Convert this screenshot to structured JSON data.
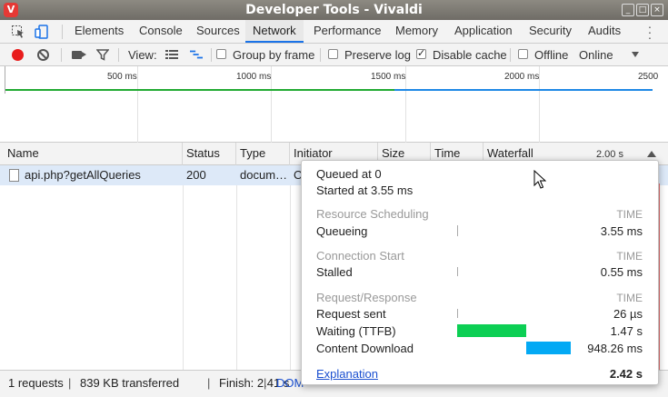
{
  "window": {
    "title": "Developer Tools - Vivaldi",
    "app_icon": "V",
    "controls": {
      "minimize": "_",
      "maximize": "□",
      "close": "×"
    }
  },
  "tabs": [
    {
      "label": "Elements",
      "active": false
    },
    {
      "label": "Console",
      "active": false
    },
    {
      "label": "Sources",
      "active": false
    },
    {
      "label": "Network",
      "active": true
    },
    {
      "label": "Performance",
      "active": false
    },
    {
      "label": "Memory",
      "active": false
    },
    {
      "label": "Application",
      "active": false
    },
    {
      "label": "Security",
      "active": false
    },
    {
      "label": "Audits",
      "active": false
    }
  ],
  "toolbar": {
    "view_label": "View:",
    "group_by_frame": {
      "label": "Group by frame",
      "checked": false
    },
    "preserve_log": {
      "label": "Preserve log",
      "checked": false
    },
    "disable_cache": {
      "label": "Disable cache",
      "checked": true
    },
    "offline": {
      "label": "Offline",
      "checked": false
    },
    "throttle": "Online"
  },
  "overview": {
    "tick_labels": [
      "500 ms",
      "1000 ms",
      "1500 ms",
      "2000 ms",
      "2500"
    ]
  },
  "table": {
    "columns": [
      "Name",
      "Status",
      "Type",
      "Initiator",
      "Size",
      "Time",
      "Waterfall"
    ],
    "waterfall_scale": "2.00 s",
    "rows": [
      {
        "name": "api.php?getAllQueries",
        "status": "200",
        "type": "docum…",
        "initiator": "O"
      }
    ]
  },
  "status": {
    "requests": "1 requests",
    "transferred": "839 KB transferred",
    "finish": "Finish: 2.41 s",
    "dom": "DOM"
  },
  "timing": {
    "queued_at": "Queued at 0",
    "started_at": "Started at 3.55 ms",
    "time_header": "TIME",
    "resource_scheduling": {
      "title": "Resource Scheduling",
      "queueing": {
        "label": "Queueing",
        "value": "3.55 ms"
      }
    },
    "connection_start": {
      "title": "Connection Start",
      "stalled": {
        "label": "Stalled",
        "value": "0.55 ms"
      }
    },
    "request_response": {
      "title": "Request/Response",
      "request_sent": {
        "label": "Request sent",
        "value": "26 µs"
      },
      "waiting": {
        "label": "Waiting (TTFB)",
        "value": "1.47 s"
      },
      "download": {
        "label": "Content Download",
        "value": "948.26 ms"
      }
    },
    "explanation": "Explanation",
    "total": "2.42 s"
  },
  "colors": {
    "waiting_bar": "#0ccf54",
    "download_bar": "#03a9f4",
    "record": "#e81c1c",
    "active_tab": "#1a73e8"
  }
}
